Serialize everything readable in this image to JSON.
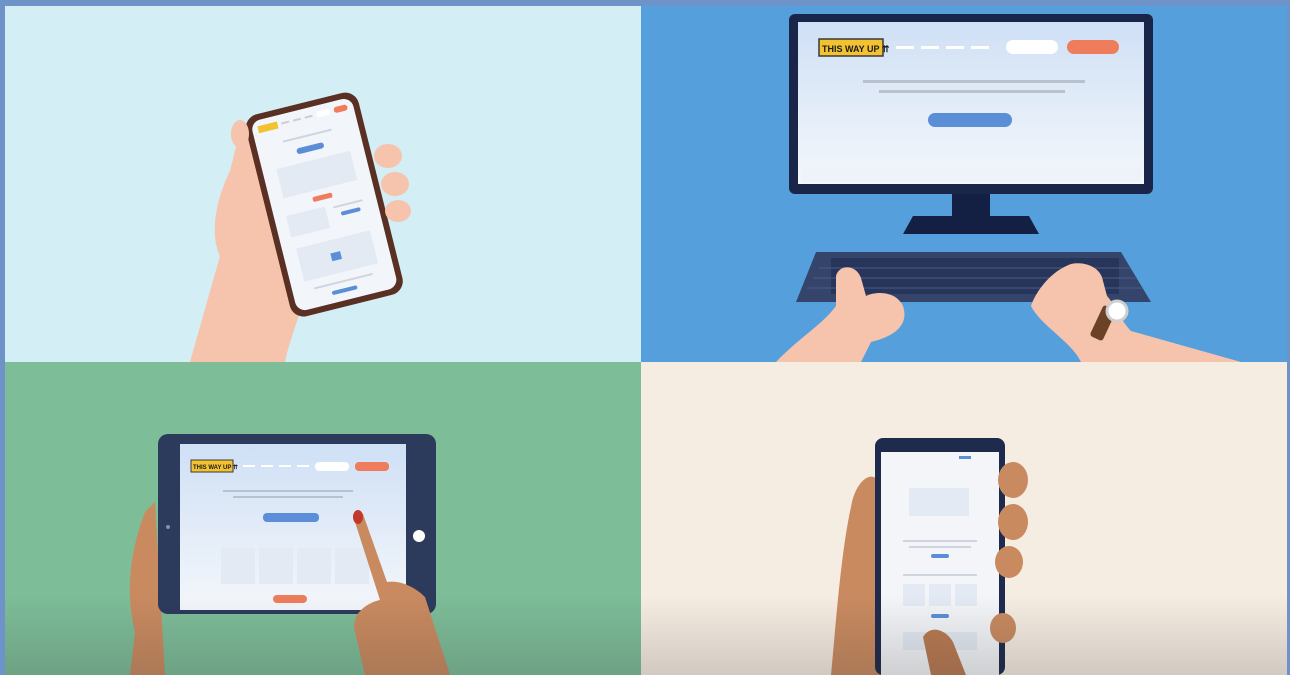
{
  "brand": {
    "logo_text": "THIS WAY UP ⇈",
    "logo_color": "#f2c230"
  },
  "colors": {
    "primary_button": "#5b8ed6",
    "accent_button": "#ee7c5d",
    "skin_light": "#f6c3ac",
    "skin_dark": "#c98a60",
    "device_dark": "#1f2b4d"
  },
  "scenes": [
    {
      "id": "phone-hand",
      "device": "smartphone"
    },
    {
      "id": "desktop-keyboard",
      "device": "desktop-monitor"
    },
    {
      "id": "tablet-touch",
      "device": "tablet"
    },
    {
      "id": "phone-scroll",
      "device": "smartphone"
    }
  ]
}
